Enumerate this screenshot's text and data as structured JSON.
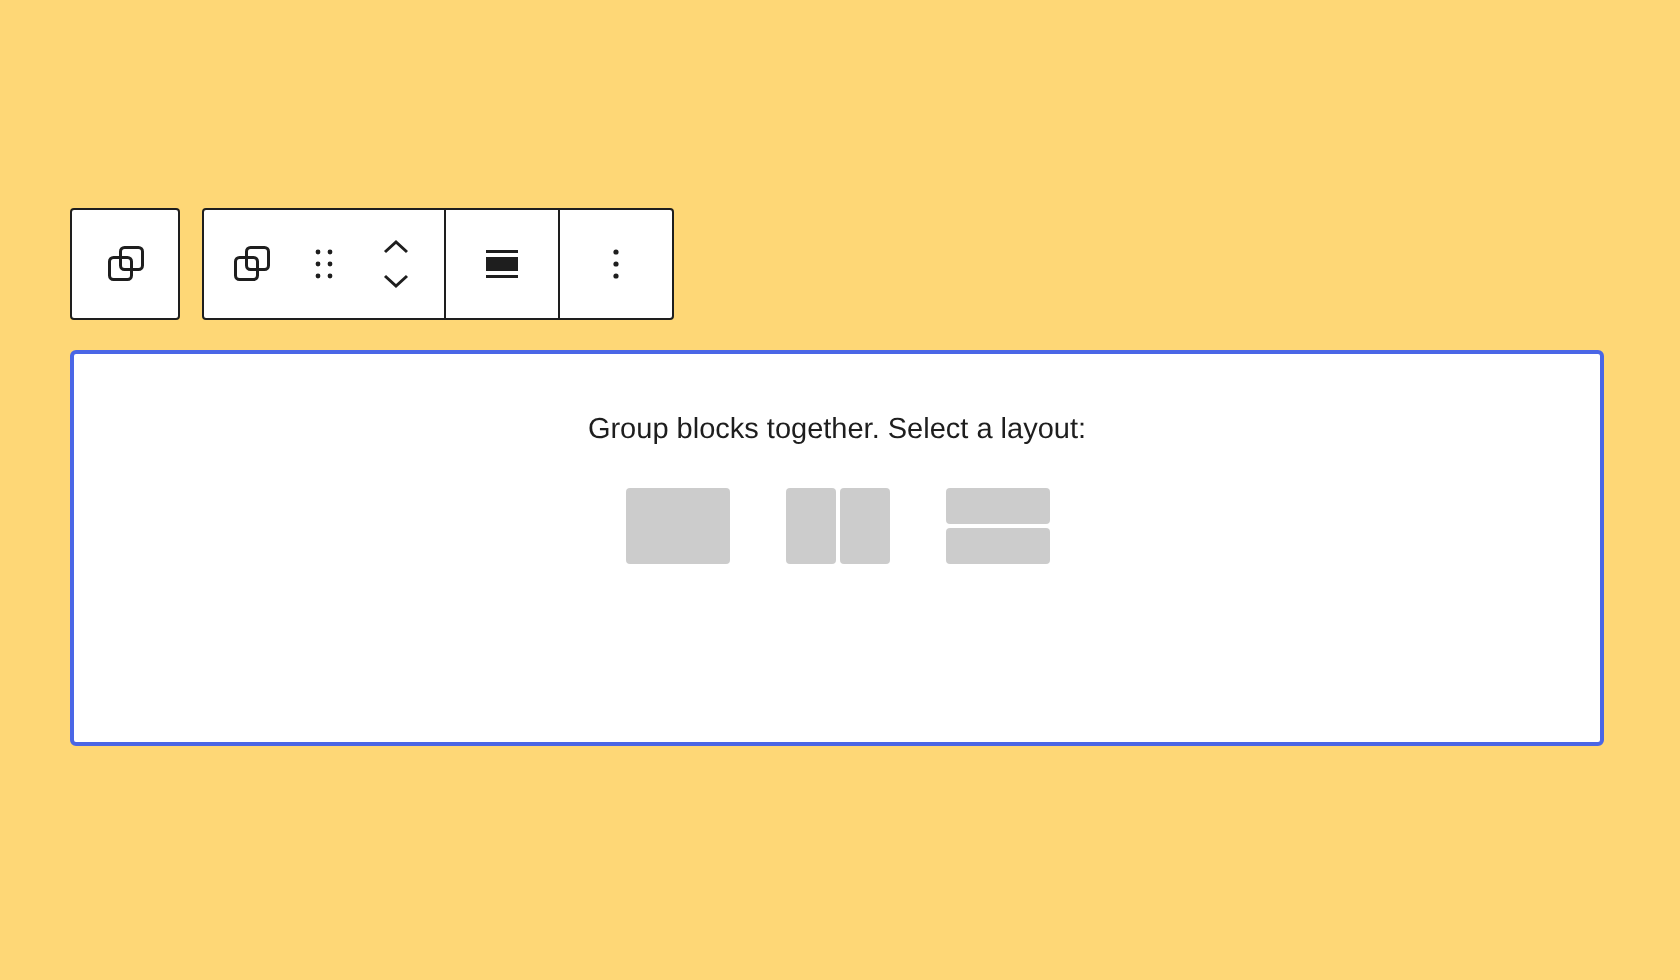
{
  "block": {
    "prompt": "Group blocks together. Select a layout:",
    "layouts": [
      {
        "kind": "single"
      },
      {
        "kind": "columns"
      },
      {
        "kind": "rows"
      }
    ]
  }
}
